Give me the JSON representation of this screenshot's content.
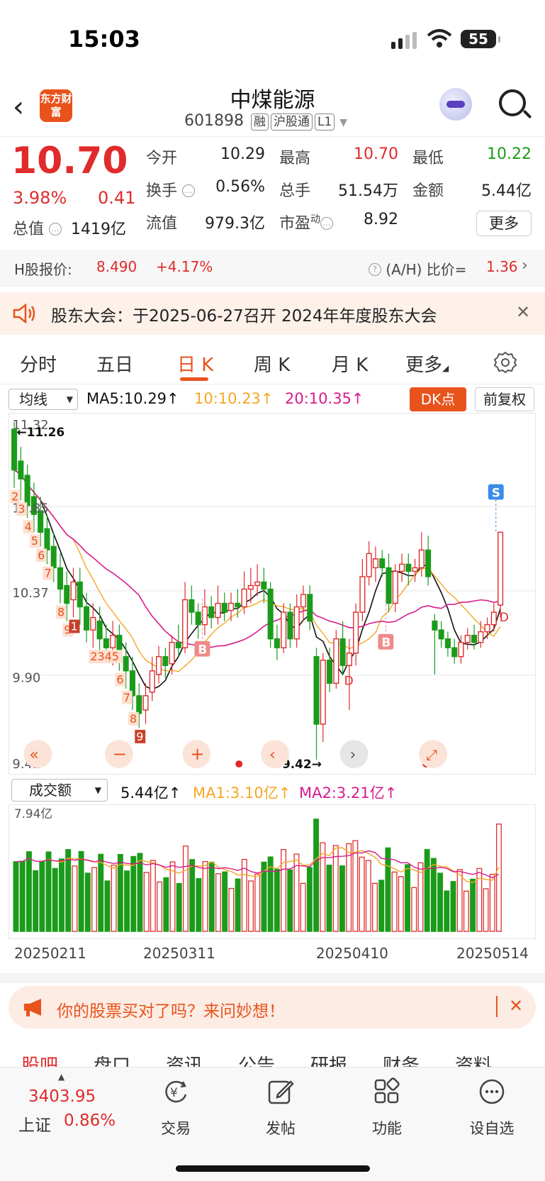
{
  "status": {
    "time": "15:03",
    "battery": "55"
  },
  "header": {
    "logo_text": "东方财富",
    "name": "中煤能源",
    "code": "601898",
    "tags": [
      "融",
      "沪股通",
      "L1"
    ]
  },
  "quote": {
    "price": "10.70",
    "pct": "3.98%",
    "chg": "0.41",
    "mcap_label": "总值",
    "mcap": "1419亿",
    "rows": [
      {
        "l": "今开",
        "v": "10.29",
        "c": "dark"
      },
      {
        "l": "最高",
        "v": "10.70",
        "c": "red"
      },
      {
        "l": "最低",
        "v": "10.22",
        "c": "green"
      },
      {
        "l": "换手",
        "v": "0.56%",
        "c": "dark"
      },
      {
        "l": "总手",
        "v": "51.54万",
        "c": "dark"
      },
      {
        "l": "金额",
        "v": "5.44亿",
        "c": "dark"
      },
      {
        "l": "流值",
        "v": "979.3亿",
        "c": "dark"
      },
      {
        "l": "市盈",
        "v": "8.92",
        "c": "dark"
      }
    ],
    "pe_sup": "动",
    "more": "更多"
  },
  "hshare": {
    "label": "H股报价:",
    "price": "8.490",
    "pct": "+4.17%",
    "ah_label": "(A/H) 比价=",
    "ah": "1.36"
  },
  "notice": {
    "text": "股东大会：于2025-06-27召开 2024年年度股东大会"
  },
  "tabs": [
    "分时",
    "五日",
    "日 K",
    "周 K",
    "月 K",
    "更多"
  ],
  "active_tab": 2,
  "ma": {
    "select": "均线",
    "ma5": "MA5:10.29",
    "ma10": "10:10.23",
    "ma20": "20:10.35",
    "dk": "DK点",
    "fq": "前复权"
  },
  "kchart": {
    "y_labels": [
      "11.32",
      "10.85",
      "10.37",
      "9.90",
      "9.42"
    ],
    "high_mark": "11.26",
    "low_mark": "9.42",
    "nine_labels": [
      "2",
      "3",
      "4",
      "5",
      "6",
      "7",
      "8",
      "9",
      "1",
      "2345",
      "6",
      "7",
      "8",
      "9"
    ],
    "signal_b": "B",
    "signal_d": "D",
    "signal_s": "S"
  },
  "vol": {
    "select": "成交额",
    "val": "5.44亿",
    "ma1": "MA1:3.10亿",
    "ma2": "MA2:3.21亿",
    "max_label": "7.94亿"
  },
  "dates": [
    "20250211",
    "20250311",
    "20250410",
    "20250514"
  ],
  "promo": {
    "text": "你的股票买对了吗？来问妙想！"
  },
  "subtabs": [
    "股吧",
    "盘口",
    "资讯",
    "公告",
    "研报",
    "财务",
    "资料"
  ],
  "bottom": {
    "idx_val": "3403.95",
    "idx_name": "上证",
    "idx_pct": "0.86%",
    "nav": [
      "交易",
      "发帖",
      "功能",
      "设自选"
    ]
  },
  "colors": {
    "up": "#e02b2b",
    "down": "#1a9c1a",
    "accent": "#e8531c",
    "ma5": "#111111",
    "ma10": "#f5a623",
    "ma20": "#d81b8c"
  },
  "chart_data": {
    "type": "candlestick",
    "ylim": [
      9.42,
      11.32
    ],
    "candles": [
      [
        11.28,
        11.05,
        11.32,
        10.95
      ],
      [
        11.1,
        11.0,
        11.18,
        10.88
      ],
      [
        11.02,
        10.85,
        11.08,
        10.78
      ],
      [
        10.9,
        10.8,
        10.98,
        10.7
      ],
      [
        10.82,
        10.7,
        10.9,
        10.62
      ],
      [
        10.72,
        10.6,
        10.8,
        10.52
      ],
      [
        10.62,
        10.5,
        10.7,
        10.42
      ],
      [
        10.5,
        10.38,
        10.58,
        10.3
      ],
      [
        10.4,
        10.3,
        10.48,
        10.2
      ],
      [
        10.32,
        10.42,
        10.5,
        10.22
      ],
      [
        10.42,
        10.28,
        10.5,
        10.18
      ],
      [
        10.28,
        10.15,
        10.36,
        10.08
      ],
      [
        10.15,
        10.22,
        10.3,
        10.05
      ],
      [
        10.2,
        10.1,
        10.28,
        10.0
      ],
      [
        10.1,
        10.05,
        10.18,
        9.98
      ],
      [
        10.05,
        10.12,
        10.2,
        9.95
      ],
      [
        10.12,
        10.0,
        10.18,
        9.92
      ],
      [
        10.0,
        9.92,
        10.08,
        9.82
      ],
      [
        9.92,
        9.78,
        10.0,
        9.7
      ],
      [
        9.78,
        9.68,
        9.85,
        9.6
      ],
      [
        9.7,
        9.78,
        9.85,
        9.62
      ],
      [
        9.8,
        9.92,
        10.0,
        9.75
      ],
      [
        9.9,
        10.0,
        10.06,
        9.85
      ],
      [
        10.0,
        9.95,
        10.05,
        9.88
      ],
      [
        9.96,
        10.08,
        10.12,
        9.9
      ],
      [
        10.08,
        10.05,
        10.18,
        10.0
      ],
      [
        10.05,
        10.32,
        10.42,
        10.02
      ],
      [
        10.32,
        10.25,
        10.4,
        10.18
      ],
      [
        10.25,
        10.18,
        10.3,
        10.1
      ],
      [
        10.18,
        10.28,
        10.38,
        10.12
      ],
      [
        10.28,
        10.22,
        10.34,
        10.16
      ],
      [
        10.22,
        10.3,
        10.4,
        10.18
      ],
      [
        10.3,
        10.25,
        10.36,
        10.2
      ],
      [
        10.26,
        10.3,
        10.36,
        10.2
      ],
      [
        10.3,
        10.28,
        10.38,
        10.22
      ],
      [
        10.28,
        10.38,
        10.48,
        10.24
      ],
      [
        10.38,
        10.4,
        10.5,
        10.3
      ],
      [
        10.4,
        10.42,
        10.52,
        10.34
      ],
      [
        10.42,
        10.38,
        10.5,
        10.3
      ],
      [
        10.38,
        10.1,
        10.42,
        10.05
      ],
      [
        10.1,
        10.05,
        10.18,
        9.98
      ],
      [
        10.05,
        10.25,
        10.3,
        10.02
      ],
      [
        10.25,
        10.1,
        10.3,
        10.05
      ],
      [
        10.1,
        10.28,
        10.35,
        10.05
      ],
      [
        10.28,
        10.35,
        10.4,
        10.2
      ],
      [
        10.35,
        10.2,
        10.4,
        10.15
      ],
      [
        10.0,
        9.62,
        10.05,
        9.42
      ],
      [
        9.62,
        9.98,
        10.02,
        9.52
      ],
      [
        9.98,
        9.85,
        10.05,
        9.8
      ],
      [
        9.85,
        10.1,
        10.15,
        9.82
      ],
      [
        10.1,
        9.95,
        10.2,
        9.9
      ],
      [
        9.95,
        10.02,
        10.1,
        9.7
      ],
      [
        10.02,
        10.25,
        10.3,
        9.95
      ],
      [
        10.25,
        10.45,
        10.55,
        10.2
      ],
      [
        10.45,
        10.58,
        10.65,
        10.4
      ],
      [
        10.5,
        10.55,
        10.62,
        10.42
      ],
      [
        10.55,
        10.5,
        10.6,
        10.45
      ],
      [
        10.5,
        10.3,
        10.58,
        10.25
      ],
      [
        10.3,
        10.48,
        10.52,
        10.25
      ],
      [
        10.48,
        10.52,
        10.58,
        10.42
      ],
      [
        10.52,
        10.48,
        10.58,
        10.4
      ],
      [
        10.48,
        10.5,
        10.55,
        10.42
      ],
      [
        10.5,
        10.6,
        10.7,
        10.45
      ],
      [
        10.6,
        10.45,
        10.68,
        10.4
      ],
      [
        10.2,
        10.15,
        10.24,
        9.9
      ],
      [
        10.15,
        10.1,
        10.2,
        10.05
      ],
      [
        10.1,
        10.05,
        10.14,
        10.0
      ],
      [
        10.05,
        10.0,
        10.1,
        9.96
      ],
      [
        10.0,
        10.08,
        10.12,
        9.96
      ],
      [
        10.08,
        10.12,
        10.16,
        10.04
      ],
      [
        10.12,
        10.08,
        10.18,
        10.04
      ],
      [
        10.08,
        10.14,
        10.2,
        10.05
      ],
      [
        10.14,
        10.18,
        10.22,
        10.1
      ],
      [
        10.18,
        10.25,
        10.3,
        10.14
      ],
      [
        10.29,
        10.7,
        10.7,
        10.22
      ]
    ],
    "volume_max": 7.94
  }
}
